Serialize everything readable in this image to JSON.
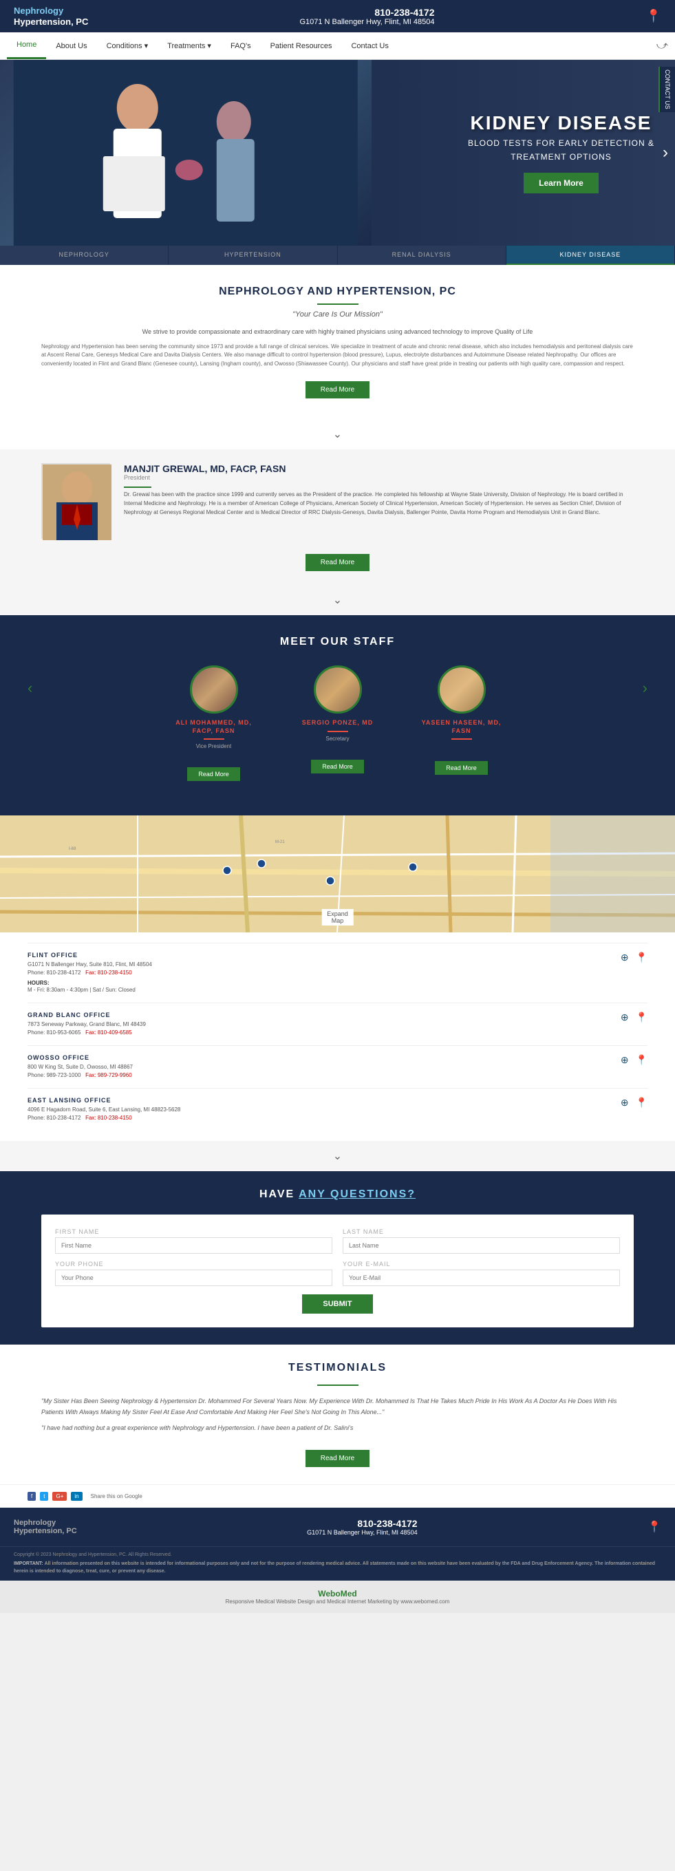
{
  "header": {
    "logo_line1": "Nephrology",
    "logo_line2": "Hypertension, PC",
    "phone": "810-238-4172",
    "address": "G1071 N Ballenger Hwy, Flint, MI 48504"
  },
  "nav": {
    "items": [
      {
        "label": "Home",
        "active": true
      },
      {
        "label": "About Us",
        "active": false
      },
      {
        "label": "Conditions ▾",
        "active": false
      },
      {
        "label": "Treatments ▾",
        "active": false
      },
      {
        "label": "FAQ's",
        "active": false
      },
      {
        "label": "Patient Resources",
        "active": false
      },
      {
        "label": "Contact Us",
        "active": false
      }
    ]
  },
  "hero": {
    "title": "KIDNEY DISEASE",
    "subtitle": "BLOOD TESTS FOR EARLY DETECTION &",
    "subtitle2": "TREATMENT OPTIONS",
    "cta_label": "Learn More",
    "contact_badge": "CONTACT US"
  },
  "hero_tabs": [
    {
      "label": "NEPHROLOGY",
      "active": false
    },
    {
      "label": "HYPERTENSION",
      "active": false
    },
    {
      "label": "RENAL DIALYSIS",
      "active": false
    },
    {
      "label": "KIDNEY DISEASE",
      "active": true
    }
  ],
  "about": {
    "title": "NEPHROLOGY AND HYPERTENSION, PC",
    "subtitle": "\"Your Care Is Our Mission\"",
    "tagline": "We strive to provide compassionate and extraordinary care with highly trained physicians using advanced technology to improve Quality of Life",
    "body": "Nephrology and Hypertension has been serving the community since 1973 and provide a full range of clinical services. We specialize in treatment of acute and chronic renal disease, which also includes hemodialysis and peritoneal dialysis care at Ascent Renal Care, Genesys Medical Care and Davita Dialysis Centers. We also manage difficult to control hypertension (blood pressure), Lupus, electrolyte disturbances and Autoimmune Disease related Nephropathy. Our offices are conveniently located in Flint and Grand Blanc (Genesee county), Lansing (Ingham county), and Owosso (Shiawassee County). Our physicians and staff have great pride in treating our patients with high quality care, compassion and respect.",
    "read_more": "Read More"
  },
  "doctor": {
    "name": "MANJIT GREWAL, MD, FACP, FASN",
    "title": "President",
    "bio": "Dr. Grewal has been with the practice since 1999 and currently serves as the President of the practice. He completed his fellowship at Wayne State University, Division of Nephrology. He is board certified in Internal Medicine and Nephrology. He is a member of American College of Physicians, American Society of Clinical Hypertension, American Society of Hypertension. He serves as Section Chief, Division of Nephrology at Genesys Regional Medical Center and is Medical Director of RRC Dialysis-Genesys, Davita Dialysis, Ballenger Pointe, Davita Home Program and Hemodialysis Unit in Grand Blanc.",
    "read_more": "Read More"
  },
  "staff": {
    "title": "MEET OUR STAFF",
    "members": [
      {
        "name": "ALI MOHAMMED, MD, FACP, FASN",
        "role": "Vice President",
        "read_more": "Read More"
      },
      {
        "name": "SERGIO PONZE, MD",
        "role": "Secretary",
        "read_more": "Read More"
      },
      {
        "name": "YASEEN HASEEN, MD, FASN",
        "role": "",
        "read_more": "Read More"
      }
    ]
  },
  "map": {
    "expand_label": "Expand Map"
  },
  "offices": [
    {
      "name": "FLINT OFFICE",
      "address": "G1071 N Ballenger Hwy, Suite 810, Flint, MI 48504",
      "phone": "Phone: 810-238-4172",
      "fax": "Fax: 810-238-4150",
      "hours_label": "HOURS:",
      "hours": "M - Fri: 8:30am - 4:30pm | Sat / Sun: Closed"
    },
    {
      "name": "GRAND BLANC OFFICE",
      "address": "7873 Seneway Parkway, Grand Blanc, MI 48439",
      "phone": "Phone: 810-953-6065",
      "fax": "Fax: 810-409-6585"
    },
    {
      "name": "OWOSSO OFFICE",
      "address": "800 W King St, Suite D, Owosso, MI 48867",
      "phone": "Phone: 989-723-1000",
      "fax": "Fax: 989-729-9960"
    },
    {
      "name": "EAST LANSING OFFICE",
      "address": "4096 E Hagadorn Road, Suite 6, East Lansing, MI 48823-5628",
      "phone": "Phone: 810-238-4172",
      "fax": "Fax: 810-238-4150"
    }
  ],
  "contact_form": {
    "title": "HAVE",
    "title_underline": "ANY QUESTIONS?",
    "first_name_label": "FIRST NAME",
    "first_name_placeholder": "First Name",
    "last_name_label": "LAST NAME",
    "last_name_placeholder": "Last Name",
    "phone_label": "YOUR PHONE",
    "phone_placeholder": "Your Phone",
    "email_label": "YOUR E-MAIL",
    "email_placeholder": "Your E-Mail",
    "submit_label": "SUBMIT"
  },
  "testimonials": {
    "title": "TESTIMONIALS",
    "text1": "\"My Sister Has Been Seeing Nephrology & Hypertension Dr. Mohammed For Several Years Now. My Experience With Dr. Mohammed Is That He Takes Much Pride In His Work As A Doctor As He Does With His Patients With Always Making My Sister Feel At Ease And Comfortable And Making Her Feel She's Not Going In This Alone...\"",
    "text2": "\"I have had nothing but a great experience with Nephrology and Hypertension. I have been a patient of Dr. Salini's",
    "read_more": "Read More"
  },
  "footer": {
    "social": [
      "fb",
      "tw",
      "G+",
      "in",
      "Share this on Google"
    ],
    "logo_line1": "Nephrology",
    "logo_line2": "Hypertension, PC",
    "phone": "810-238-4172",
    "address": "G1071 N Ballenger Hwy, Flint, MI 48504",
    "copyright": "Copyright © 2023 Nephrology and Hypertension, PC. All Rights Reserved.",
    "disclaimer_bold": "IMPORTANT:",
    "disclaimer": "All information presented on this website is intended for informational purposes only and not for the purpose of rendering medical advice. All statements made on this website have been evaluated by the FDA and Drug Enforcement Agency. The information contained herein is intended to diagnose, treat, cure, or prevent any disease.",
    "webomed_text": "Responsive Medical Website Design and Medical Internet Marketing by www.webomed.com",
    "webomed_logo": "Web"
  }
}
